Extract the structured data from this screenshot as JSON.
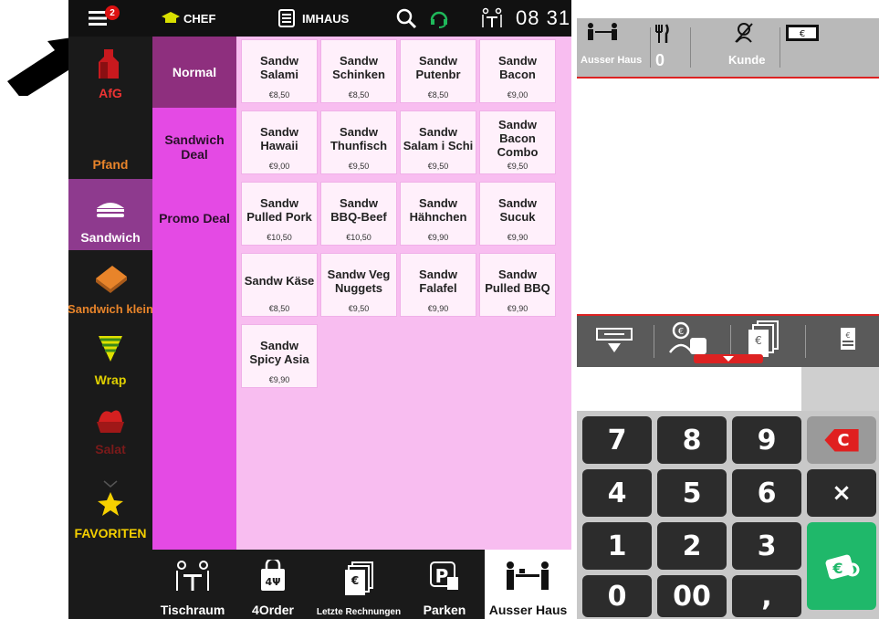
{
  "topbar": {
    "badge": "2",
    "user": "CHEF",
    "mode": "IMHAUS",
    "time": "08 31"
  },
  "categories": [
    {
      "label": "AfG",
      "icon": "bottle-icon"
    },
    {
      "label": "Pfand",
      "icon": "deposit-icon"
    },
    {
      "label": "Sandwich",
      "icon": "sandwich-icon"
    },
    {
      "label": "Sandwich klein",
      "icon": "small-sandwich-icon"
    },
    {
      "label": "Wrap",
      "icon": "wrap-icon"
    },
    {
      "label": "Salat",
      "icon": "salad-icon"
    },
    {
      "label": "FAVORITEN",
      "icon": "star-icon"
    }
  ],
  "subcategories": [
    {
      "label": "Normal"
    },
    {
      "label": "Sandwich Deal"
    },
    {
      "label": "Promo Deal"
    }
  ],
  "products": [
    {
      "name": "Sandw Salami",
      "price": "€8,50"
    },
    {
      "name": "Sandw Schinken",
      "price": "€8,50"
    },
    {
      "name": "Sandw Putenbr",
      "price": "€8,50"
    },
    {
      "name": "Sandw Bacon",
      "price": "€9,00"
    },
    {
      "name": "Sandw Hawaii",
      "price": "€9,00"
    },
    {
      "name": "Sandw Thunfisch",
      "price": "€9,50"
    },
    {
      "name": "Sandw Salam i Schi",
      "price": "€9,50"
    },
    {
      "name": "Sandw Bacon Combo",
      "price": "€9,50"
    },
    {
      "name": "Sandw Pulled Pork",
      "price": "€10,50"
    },
    {
      "name": "Sandw BBQ-Beef",
      "price": "€10,50"
    },
    {
      "name": "Sandw Hähnchen",
      "price": "€9,90"
    },
    {
      "name": "Sandw Sucuk",
      "price": "€9,90"
    },
    {
      "name": "Sandw Käse",
      "price": "€8,50"
    },
    {
      "name": "Sandw Veg Nuggets",
      "price": "€9,50"
    },
    {
      "name": "Sandw Falafel",
      "price": "€9,90"
    },
    {
      "name": "Sandw Pulled BBQ",
      "price": "€9,90"
    },
    {
      "name": "Sandw Spicy Asia",
      "price": "€9,90"
    }
  ],
  "bottom": [
    {
      "label": "Tischraum"
    },
    {
      "label": "4Order"
    },
    {
      "label": "Letzte Rechnungen"
    },
    {
      "label": "Parken"
    },
    {
      "label": "Ausser Haus"
    }
  ],
  "right": {
    "order_type": "Ausser Haus",
    "covers": "0",
    "customer": "Kunde"
  },
  "keypad": [
    "7",
    "8",
    "9",
    "4",
    "5",
    "6",
    "1",
    "2",
    "3",
    "0",
    "00",
    ","
  ],
  "keypad_clear": "C",
  "keypad_multiply": "×",
  "colors": {
    "accent_magenta": "#e44ae4",
    "selected_purple": "#8e3a8e",
    "orange_label": "#e8842a",
    "pay_green": "#1fb86a",
    "clear_red": "#e02020"
  }
}
